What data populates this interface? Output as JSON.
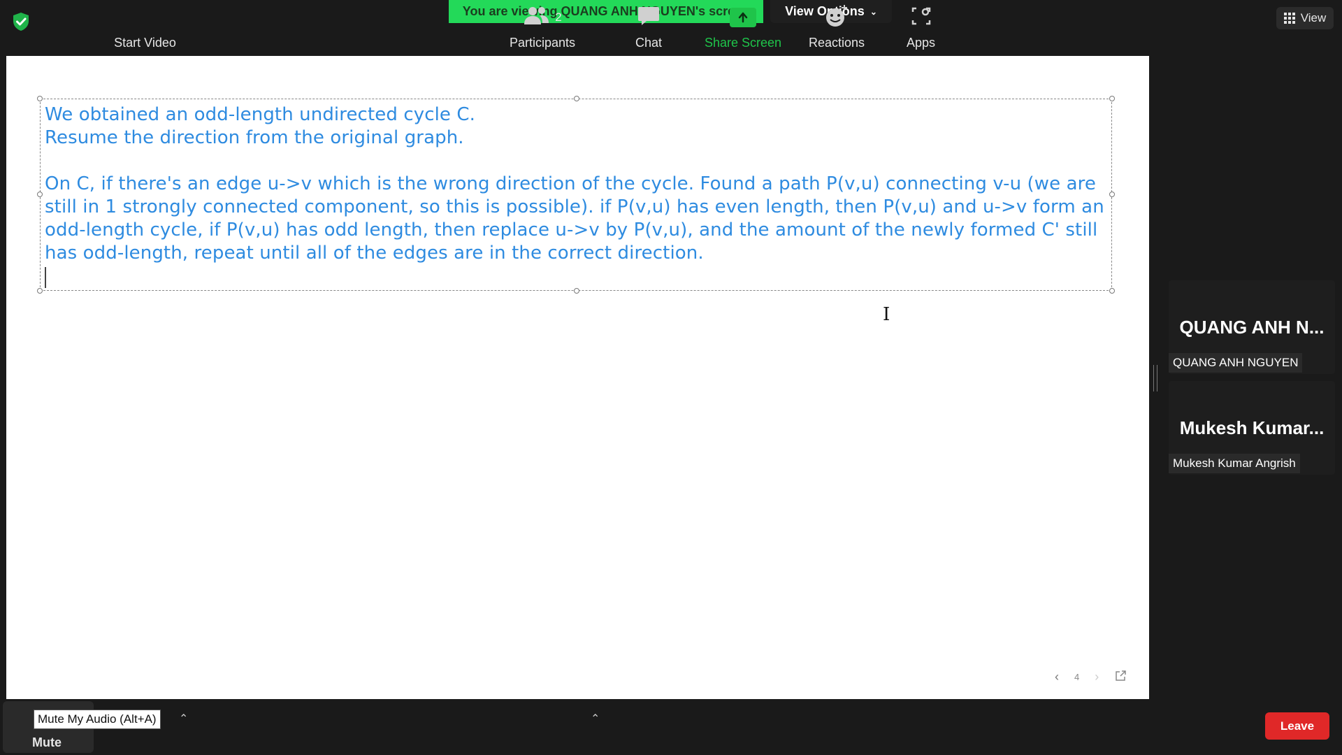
{
  "top_bar": {
    "banner_text": "You are viewing QUANG ANH NGUYEN's screen",
    "view_options_label": "View Options",
    "view_button_label": "View",
    "banner_color": "#23d959"
  },
  "shared_content": {
    "text_color": "#2e8be0",
    "paragraphs": [
      "We obtained an odd-length undirected cycle C.",
      "Resume the direction from the original graph.",
      "On C, if there's an edge u->v which is the wrong direction of the cycle. Found a path P(v,u) connecting v-u (we are still in 1 strongly connected component, so this is possible). if P(v,u) has even length, then P(v,u) and u->v form an odd-length cycle, if P(v,u) has odd length, then replace u->v by P(v,u), and the amount of the newly formed C' still has odd-length, repeat until all of the edges are in the correct direction."
    ],
    "page_number": "4"
  },
  "participants_panel": {
    "tiles": [
      {
        "big_name": "QUANG ANH N...",
        "name_tag": "QUANG ANH NGUYEN"
      },
      {
        "big_name": "Mukesh  Kumar...",
        "name_tag": "Mukesh Kumar Angrish"
      }
    ]
  },
  "toolbar": {
    "mute_label": "Mute",
    "mute_tooltip": "Mute My Audio (Alt+A)",
    "start_video_label": "Start Video",
    "participants_label": "Participants",
    "participants_count": "2",
    "chat_label": "Chat",
    "share_screen_label": "Share Screen",
    "reactions_label": "Reactions",
    "apps_label": "Apps",
    "leave_label": "Leave",
    "share_color": "#1fc44a",
    "leave_color": "#e02828"
  }
}
